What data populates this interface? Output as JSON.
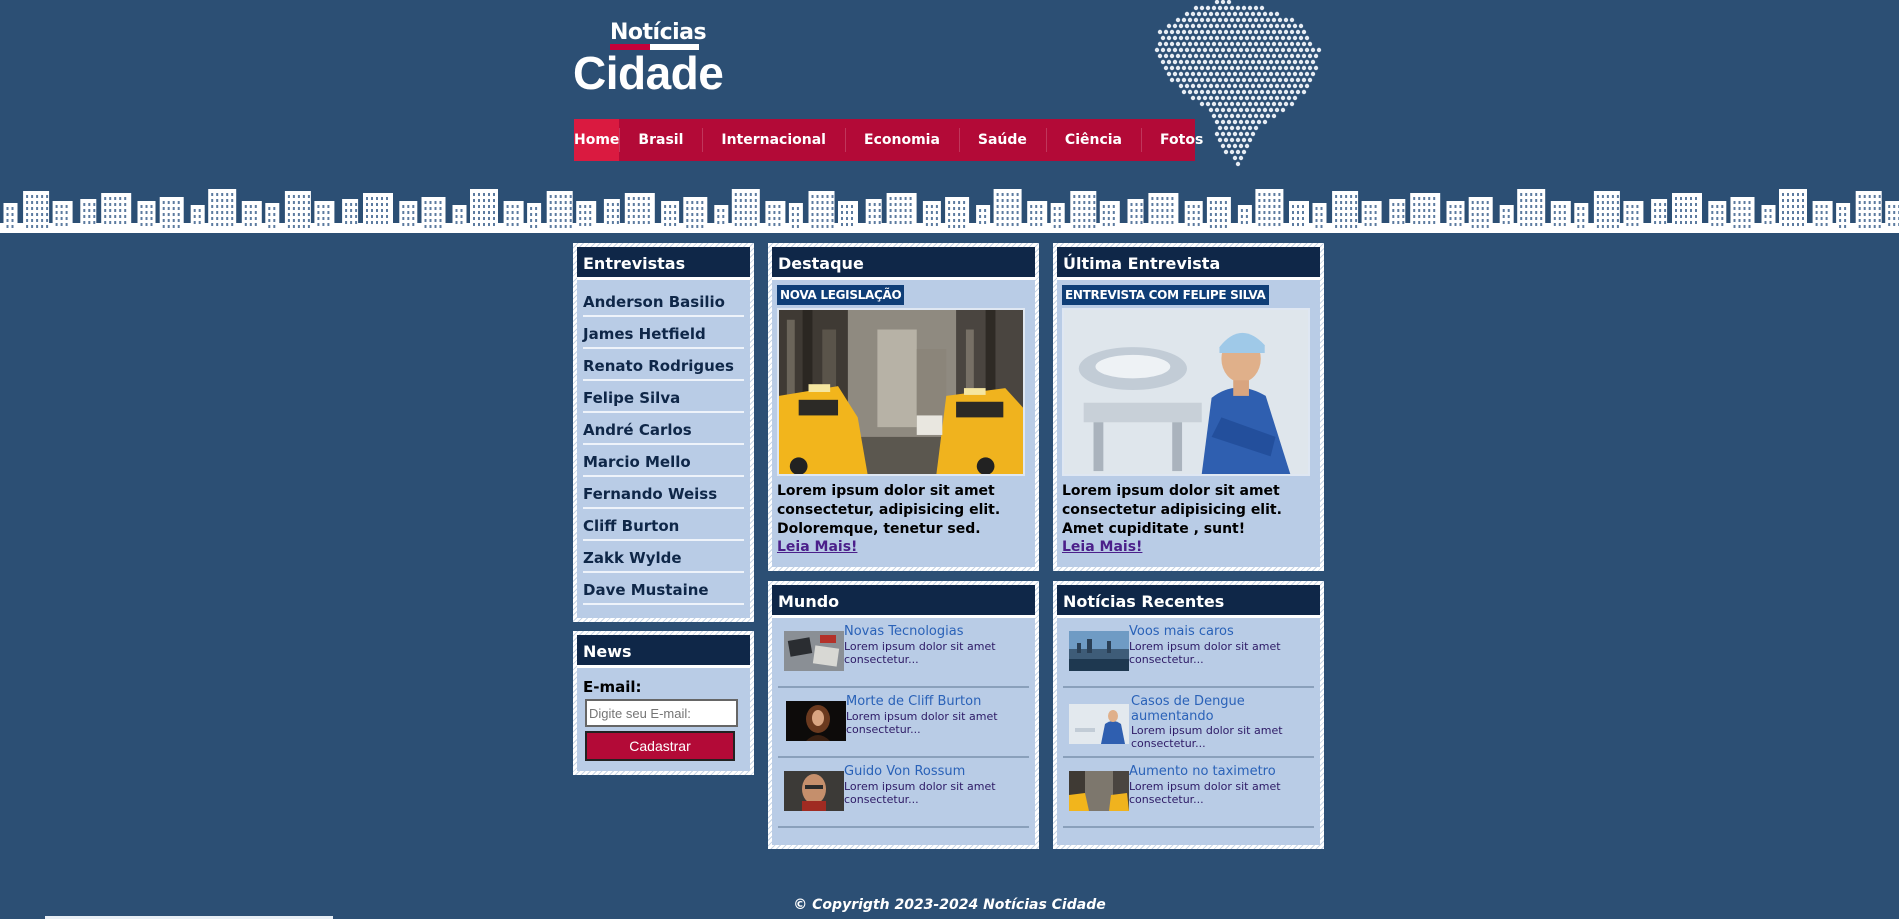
{
  "logo": {
    "top": "Notícias",
    "main": "Cidade"
  },
  "nav": {
    "items": [
      {
        "label": "Home",
        "active": true
      },
      {
        "label": "Brasil"
      },
      {
        "label": "Internacional"
      },
      {
        "label": "Economia"
      },
      {
        "label": "Saúde"
      },
      {
        "label": "Ciência"
      },
      {
        "label": "Fotos"
      }
    ]
  },
  "entrevistas": {
    "title": "Entrevistas",
    "items": [
      "Anderson Basilio",
      "James Hetfield",
      "Renato Rodrigues",
      "Felipe Silva",
      "André Carlos",
      "Marcio Mello",
      "Fernando Weiss",
      "Cliff Burton",
      "Zakk Wylde",
      "Dave Mustaine"
    ]
  },
  "news": {
    "title": "News",
    "email_label": "E-mail:",
    "email_placeholder": "Digite seu E-mail:",
    "submit_label": "Cadastrar"
  },
  "destaque": {
    "title": "Destaque",
    "tag": "NOVA LEGISLAÇÃO",
    "text": "Lorem ipsum dolor sit amet consectetur, adipisicing elit. Doloremque, tenetur sed.",
    "read_more": "Leia Mais!"
  },
  "ultima": {
    "title": "Última Entrevista",
    "tag": "ENTREVISTA COM FELIPE SILVA",
    "text": "Lorem ipsum dolor sit amet consectetur adipisicing elit. Amet cupiditate , sunt!",
    "read_more": "Leia Mais!"
  },
  "mundo": {
    "title": "Mundo",
    "items": [
      {
        "title": "Novas Tecnologias",
        "desc": "Lorem ipsum dolor sit amet consectetur..."
      },
      {
        "title": "Morte de Cliff Burton",
        "desc": "Lorem ipsum dolor sit amet consectetur..."
      },
      {
        "title": "Guido Von Rossum",
        "desc": "Lorem ipsum dolor sit amet consectetur..."
      }
    ]
  },
  "recentes": {
    "title": "Notícias Recentes",
    "items": [
      {
        "title": "Voos mais caros",
        "desc": "Lorem ipsum dolor sit amet consectetur..."
      },
      {
        "title": "Casos de Dengue aumentando",
        "desc": "Lorem ipsum dolor sit amet consectetur..."
      },
      {
        "title": "Aumento no taximetro",
        "desc": "Lorem ipsum dolor sit amet consectetur..."
      }
    ]
  },
  "footer": {
    "text": "© Copyrigth 2023-2024 Notícias Cidade"
  },
  "colors": {
    "background": "#2c4f74",
    "accent": "#b30a37",
    "box_title": "#0f2748",
    "box_body": "#b9cce6"
  }
}
